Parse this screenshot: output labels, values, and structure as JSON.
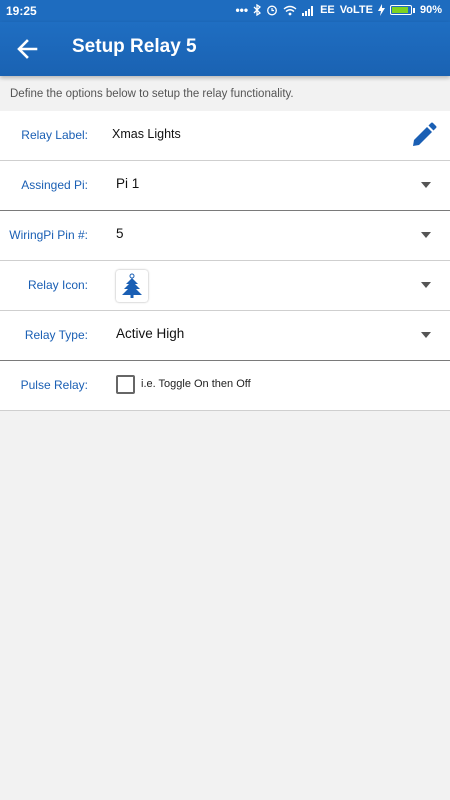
{
  "status_bar": {
    "time": "19:25",
    "carrier": "EE",
    "network": "VoLTE",
    "battery_percent": "90%",
    "battery_level": 0.9,
    "icons": [
      "bluetooth-icon",
      "alarm-icon",
      "wifi-icon",
      "signal-icon",
      "charging-icon",
      "battery-icon"
    ]
  },
  "app_bar": {
    "title": "Setup Relay 5",
    "back_icon": "arrow-left-icon"
  },
  "intro": "Define the options below to setup the relay functionality.",
  "form": {
    "relay_label": {
      "label": "Relay Label:",
      "value": "Xmas Lights",
      "icon": "pencil-icon"
    },
    "assigned_pi": {
      "label": "Assinged Pi:",
      "value": "Pi 1"
    },
    "wiringpi_pin": {
      "label": "WiringPi Pin #:",
      "value": "5"
    },
    "relay_icon": {
      "label": "Relay Icon:",
      "icon": "christmas-tree-icon"
    },
    "relay_type": {
      "label": "Relay Type:",
      "value": "Active High"
    },
    "pulse_relay": {
      "label": "Pulse Relay:",
      "checked": false,
      "checkbox_label": "i.e. Toggle On then Off"
    }
  },
  "colors": {
    "primary": "#1e6cbf",
    "label_blue": "#1a5fb4",
    "background": "#f2f2f2",
    "battery_green": "#7ed321"
  }
}
